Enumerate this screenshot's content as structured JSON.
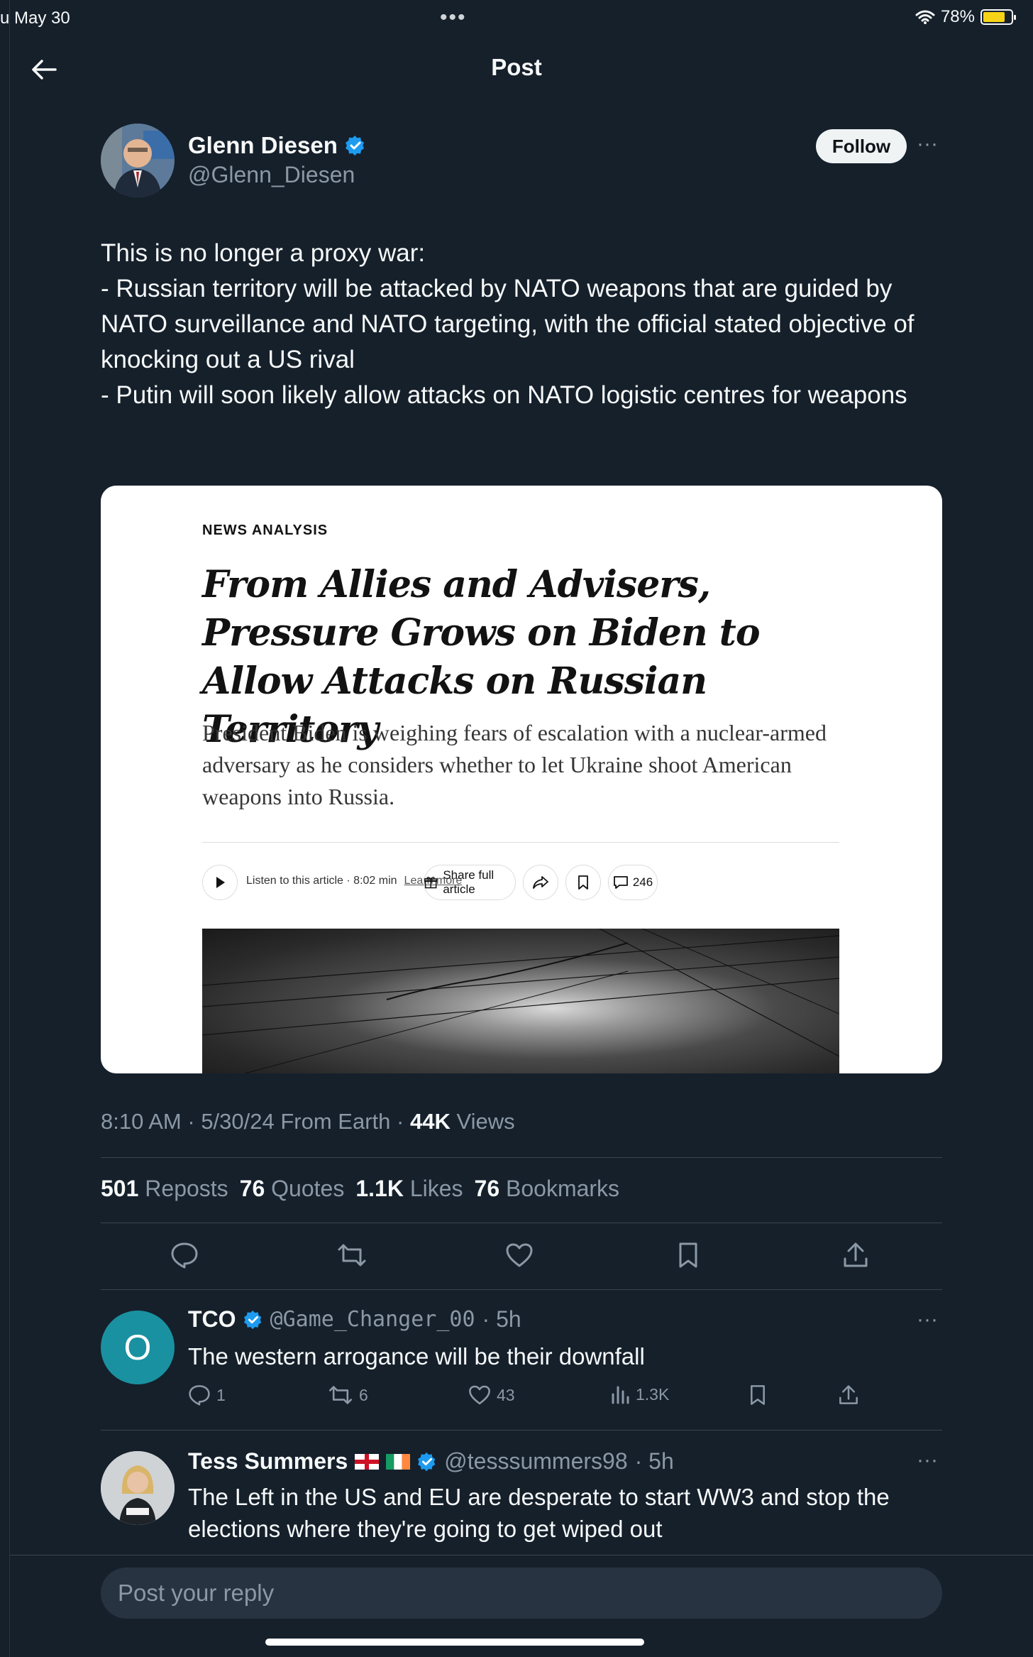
{
  "status_bar": {
    "time": "u May 30",
    "dots": "•••",
    "battery": "78%",
    "battery_level": 0.78
  },
  "header": {
    "title": "Post"
  },
  "post": {
    "author_name": "Glenn Diesen",
    "author_handle": "@Glenn_Diesen",
    "follow_label": "Follow",
    "more": "···",
    "text": "This is no longer a proxy war:\n- Russian territory will be attacked by NATO weapons that are guided by NATO surveillance and NATO targeting, with the official stated objective of knocking out a US rival\n- Putin will soon likely allow attacks on NATO logistic centres for weapons",
    "card": {
      "kicker": "NEWS ANALYSIS",
      "headline": "From Allies and Advisers, Pressure Grows on Biden to Allow Attacks on Russian Territory",
      "summary": "President Biden is weighing fears of escalation with a nuclear-armed adversary as he considers whether to let Ukraine shoot American weapons into Russia.",
      "listen_label": "Listen to this article · 8:02 min",
      "learn_more": "Learn more",
      "share_label": "Share full article",
      "comments_count": "246"
    },
    "meta": {
      "time": "8:10 AM",
      "date": "5/30/24",
      "location": "From Earth",
      "views_count": "44K",
      "views_label": "Views"
    },
    "stats": [
      {
        "num": "501",
        "label": "Reposts"
      },
      {
        "num": "76",
        "label": "Quotes"
      },
      {
        "num": "1.1K",
        "label": "Likes"
      },
      {
        "num": "76",
        "label": "Bookmarks"
      }
    ]
  },
  "replies": [
    {
      "avatar_letter": "O",
      "name": "TCO",
      "handle": "@Game_Changer_00",
      "age": "· 5h",
      "text": "The western arrogance will be their downfall",
      "replies": "1",
      "reposts": "6",
      "likes": "43",
      "views": "1.3K",
      "more": "···"
    },
    {
      "name": "Tess Summers",
      "handle": "@tesssummers98",
      "age": "· 5h",
      "text": "The Left in the US and EU are desperate to start WW3 and stop the elections where they're going to get wiped out",
      "more": "···"
    }
  ],
  "reply_box": {
    "placeholder": "Post your reply"
  },
  "colors": {
    "background": "#15202b",
    "verified": "#1d9bf0",
    "muted": "#8b98a5",
    "tco_avatar": "#1a91a0"
  }
}
